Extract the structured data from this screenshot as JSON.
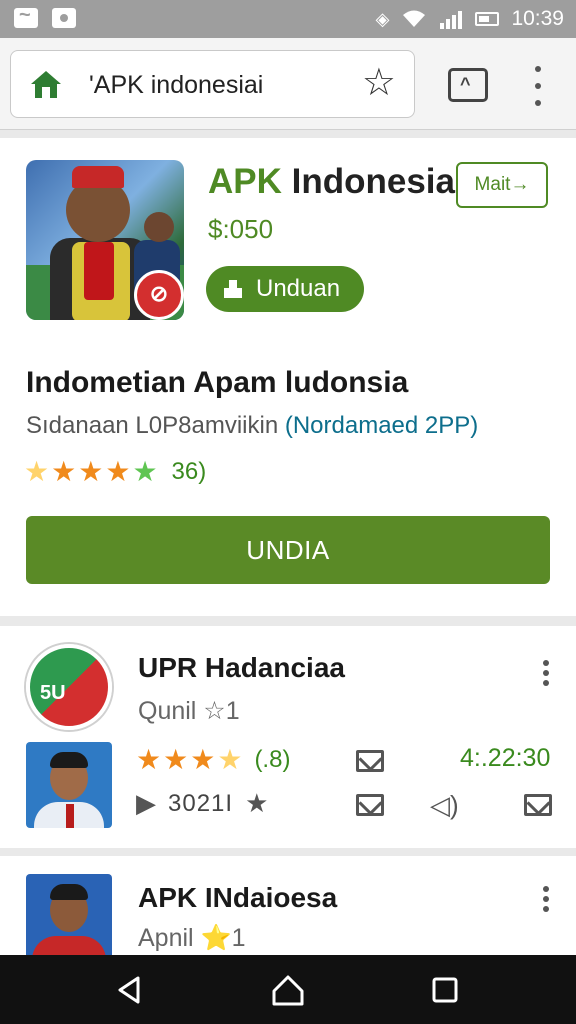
{
  "status_bar": {
    "time": "10:39",
    "icons": [
      "notification-icon",
      "record-icon",
      "vibrate-icon",
      "wifi-icon",
      "signal-icon",
      "battery-icon"
    ]
  },
  "browser": {
    "url": "'APK indonesiai",
    "icons": [
      "home-icon",
      "bookmark-star-icon",
      "tabs-icon",
      "menu-icon"
    ]
  },
  "featured": {
    "title_green": "APK",
    "title_rest": " Indonesia",
    "price": "$:050",
    "mait_label": "Mait→",
    "unduan_label": "Unduan",
    "desc_title": "Indometian Apam ludonsia",
    "desc_sub": "Sıdanaan L0P8amviikin ",
    "desc_link": "(Nordamaed 2PP)",
    "rating_count": "36)",
    "rating": 5,
    "primary_button": "UNDIA"
  },
  "list": [
    {
      "title": "UPR Hadanciaa",
      "subtitle": "Qunil ☆1",
      "logo_text": "5U",
      "rating": 3.5,
      "score": "(.8)",
      "time": "4:.22:30",
      "row2_text": "3021I"
    },
    {
      "title": "APK INdaioesa",
      "subtitle": "Apnil ⭐1"
    }
  ],
  "colors": {
    "accent_green": "#4f8a24",
    "button_green": "#5a8a26",
    "badge_red": "#d32f2f"
  }
}
